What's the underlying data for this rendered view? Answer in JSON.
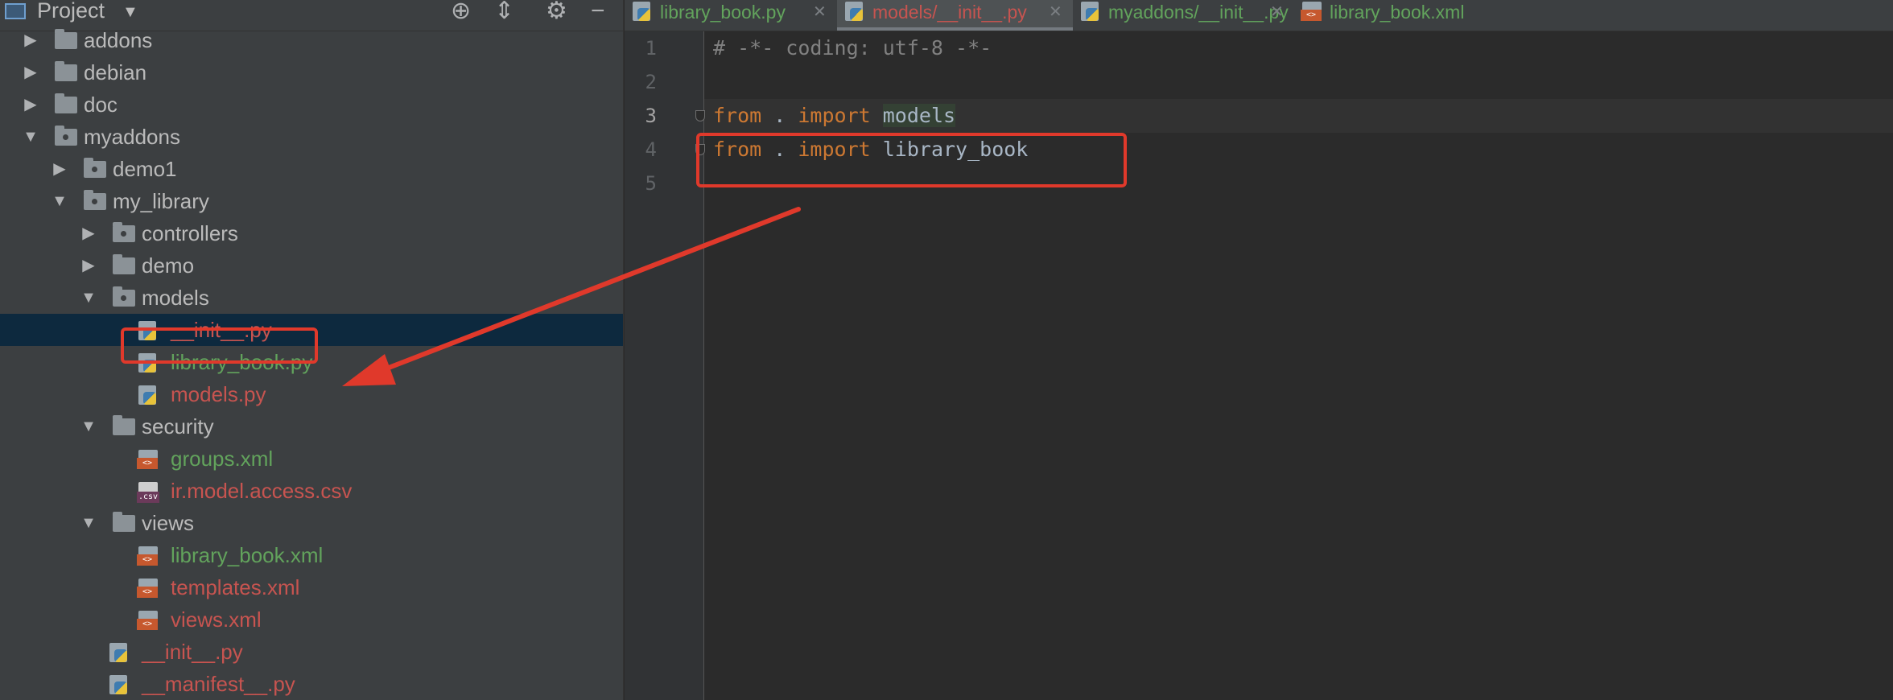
{
  "project_panel": {
    "title": "Project",
    "tree": [
      {
        "label": "addons",
        "kind": "folder",
        "depth": 0,
        "expanded": false,
        "color": "default"
      },
      {
        "label": "debian",
        "kind": "folder",
        "depth": 0,
        "expanded": false,
        "color": "default"
      },
      {
        "label": "doc",
        "kind": "folder",
        "depth": 0,
        "expanded": false,
        "color": "default"
      },
      {
        "label": "myaddons",
        "kind": "package",
        "depth": 0,
        "expanded": true,
        "color": "default"
      },
      {
        "label": "demo1",
        "kind": "package",
        "depth": 1,
        "expanded": false,
        "color": "default"
      },
      {
        "label": "my_library",
        "kind": "package",
        "depth": 1,
        "expanded": true,
        "color": "default"
      },
      {
        "label": "controllers",
        "kind": "package",
        "depth": 2,
        "expanded": false,
        "color": "default"
      },
      {
        "label": "demo",
        "kind": "folder",
        "depth": 2,
        "expanded": false,
        "color": "default"
      },
      {
        "label": "models",
        "kind": "package",
        "depth": 2,
        "expanded": true,
        "color": "default"
      },
      {
        "label": "__init__.py",
        "kind": "python",
        "depth": 3,
        "color": "red",
        "selected": true
      },
      {
        "label": "library_book.py",
        "kind": "python",
        "depth": 3,
        "color": "green"
      },
      {
        "label": "models.py",
        "kind": "python",
        "depth": 3,
        "color": "red"
      },
      {
        "label": "security",
        "kind": "folder",
        "depth": 2,
        "expanded": true,
        "color": "default"
      },
      {
        "label": "groups.xml",
        "kind": "xml",
        "depth": 3,
        "color": "green"
      },
      {
        "label": "ir.model.access.csv",
        "kind": "csv",
        "depth": 3,
        "color": "red"
      },
      {
        "label": "views",
        "kind": "folder",
        "depth": 2,
        "expanded": true,
        "color": "default"
      },
      {
        "label": "library_book.xml",
        "kind": "xml",
        "depth": 3,
        "color": "green"
      },
      {
        "label": "templates.xml",
        "kind": "xml",
        "depth": 3,
        "color": "red"
      },
      {
        "label": "views.xml",
        "kind": "xml",
        "depth": 3,
        "color": "red"
      },
      {
        "label": "__init__.py",
        "kind": "python",
        "depth": 2,
        "color": "red"
      },
      {
        "label": "__manifest__.py",
        "kind": "python",
        "depth": 2,
        "color": "red"
      }
    ]
  },
  "tabs": [
    {
      "label": "library_book.py",
      "icon": "python-file-icon",
      "color": "green",
      "active": false
    },
    {
      "label": "models/__init__.py",
      "icon": "python-file-icon",
      "color": "red",
      "active": true
    },
    {
      "label": "myaddons/__init__.py",
      "icon": "python-file-icon",
      "color": "green",
      "active": false
    },
    {
      "label": "library_book.xml",
      "icon": "xml-file-icon",
      "color": "green",
      "active": false,
      "closable": false
    }
  ],
  "editor": {
    "current_line": 3,
    "lines": [
      {
        "number": "1",
        "tokens": [
          {
            "t": "# -*- coding: utf-8 -*-",
            "c": "comment"
          }
        ]
      },
      {
        "number": "2",
        "tokens": []
      },
      {
        "number": "3",
        "tokens": [
          {
            "t": "from",
            "c": "kw"
          },
          {
            "t": " . ",
            "c": "id"
          },
          {
            "t": "import",
            "c": "kw"
          },
          {
            "t": " ",
            "c": "id"
          },
          {
            "t": "models",
            "c": "hl"
          }
        ]
      },
      {
        "number": "4",
        "tokens": [
          {
            "t": "from",
            "c": "kw"
          },
          {
            "t": " . ",
            "c": "id"
          },
          {
            "t": "import",
            "c": "kw"
          },
          {
            "t": " library_book",
            "c": "id"
          }
        ]
      },
      {
        "number": "5",
        "tokens": []
      }
    ]
  },
  "colors": {
    "annotation": "#e0392b",
    "red_file": "#c75450",
    "green_file": "#62a35c",
    "keyword": "#cc7832"
  }
}
